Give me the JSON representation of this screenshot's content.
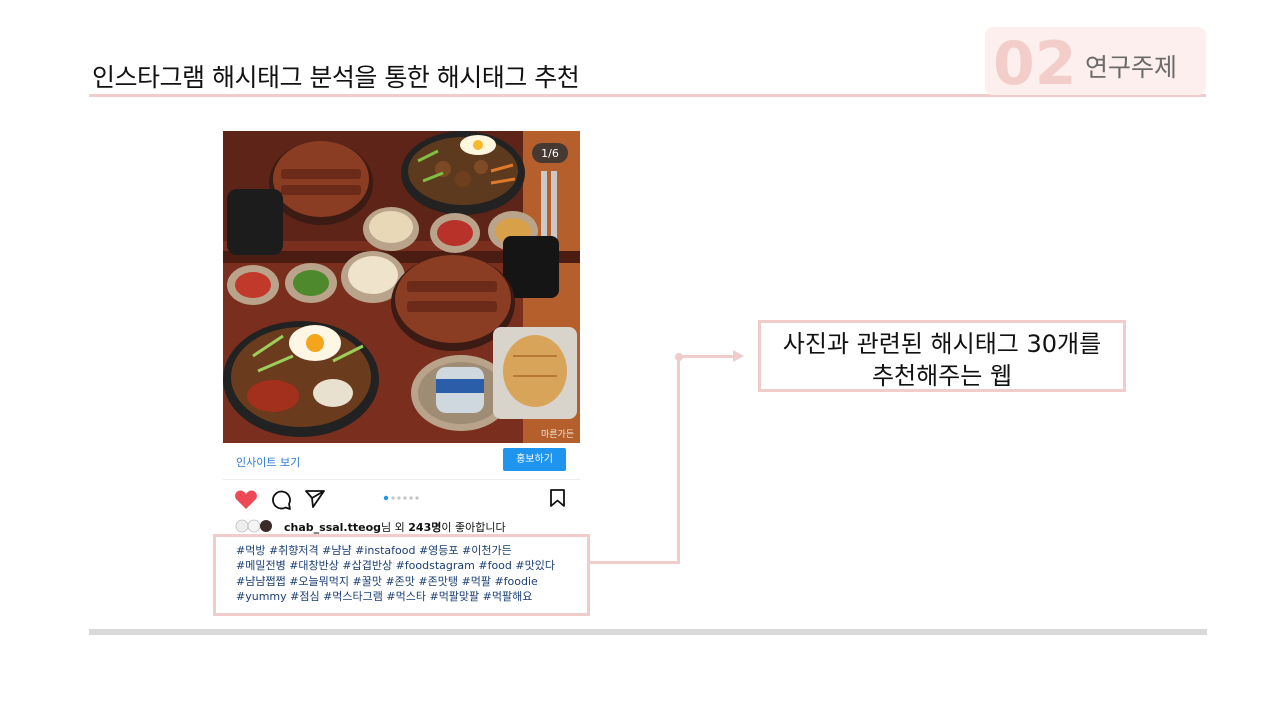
{
  "slide": {
    "title": "인스타그램 해시태그 분석을 통한 해시태그 추천",
    "section_number": "02",
    "section_label": "연구주제"
  },
  "post": {
    "image_counter": "1/6",
    "insight_link": "인사이트 보기",
    "promote_button": "홍보하기",
    "likes_username": "chab_ssal.tteog",
    "likes_mid": "님 외 ",
    "likes_count": "243명",
    "likes_suffix": "이 좋아합니다",
    "hashtag_lines": [
      "#먹방 #취향저격 #냠냠 #instafood #영등포 #이천가든",
      "#메밀전병 #대창반상 #삽겹반상 #foodstagram #food #맛있다",
      "#냠냠쩝쩝 #오늘뭐먹지 #꿀맛 #존맛 #존맛탱 #먹팔 #foodie",
      "#yummy #점심 #먹스타그램 #먹스타 #먹팔맞팔 #먹팔해요"
    ],
    "watermark": "마른가든"
  },
  "callout": {
    "line1": "사진과 관련된 해시태그 30개를",
    "line2": "추천해주는 웹"
  },
  "colors": {
    "accent_pink": "#f0cccc",
    "section_bg": "#fcefed",
    "instagram_blue": "#1f95f0",
    "heart_red": "#ed4956"
  }
}
